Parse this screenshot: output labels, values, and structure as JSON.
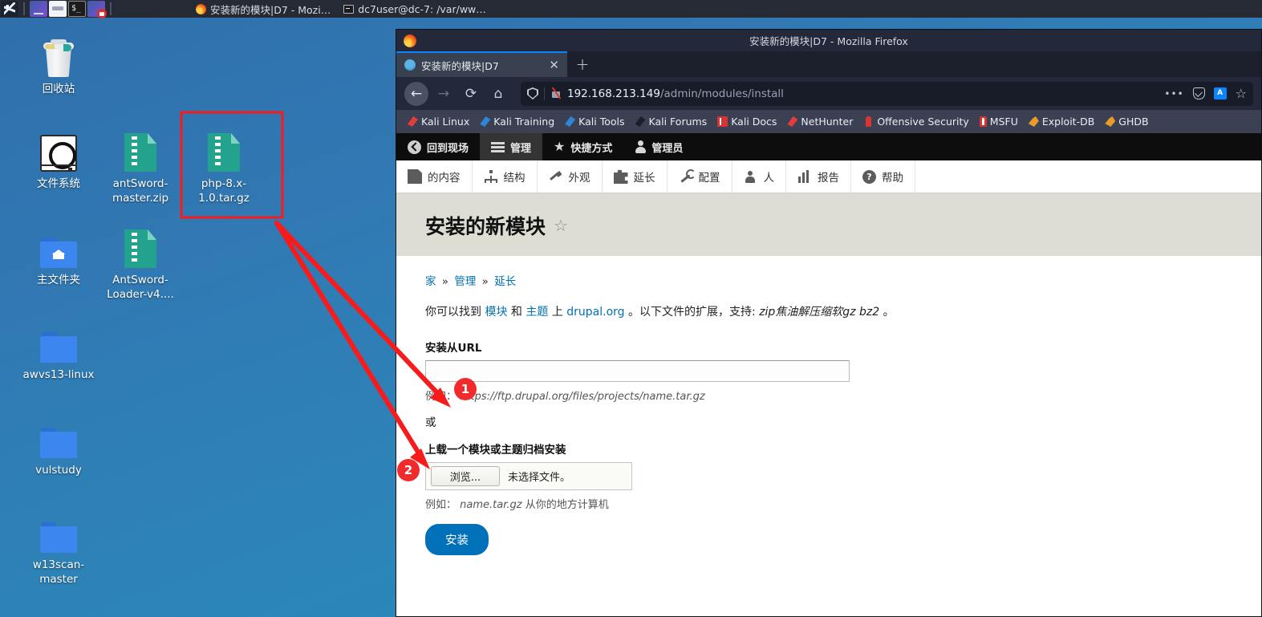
{
  "taskbar": {
    "launchers": [
      {
        "name": "kali-menu",
        "icon": "kali-dragon-icon"
      },
      {
        "name": "files-app",
        "icon": "files-icon"
      },
      {
        "name": "file-manager",
        "icon": "file-manager-icon"
      },
      {
        "name": "terminal",
        "icon": "terminal-icon",
        "glyph": "$_"
      },
      {
        "name": "screen-recorder",
        "icon": "screen-recorder-icon"
      }
    ],
    "windows": [
      {
        "title": "安装新的模块|D7 - Mozi…",
        "icon": "firefox-icon"
      },
      {
        "title": "dc7user@dc-7: /var/ww…",
        "icon": "terminal-icon"
      }
    ]
  },
  "desktop": {
    "icons": [
      {
        "label": "回收站",
        "type": "trash"
      },
      {
        "label": "文件系统",
        "type": "drive"
      },
      {
        "label": "antSword-master.zip",
        "type": "archive"
      },
      {
        "label": "php-8.x-1.0.tar.gz",
        "type": "archive",
        "highlighted": true
      },
      {
        "label": "主文件夹",
        "type": "home"
      },
      {
        "label": "AntSword-Loader-v4....",
        "type": "archive"
      },
      {
        "label": "awvs13-linux",
        "type": "folder"
      },
      {
        "label": "vulstudy",
        "type": "folder"
      },
      {
        "label": "w13scan-master",
        "type": "folder"
      }
    ]
  },
  "annotations": {
    "highlight_color": "#f81b1b",
    "badges": [
      {
        "label": "1"
      },
      {
        "label": "2"
      }
    ]
  },
  "browser": {
    "window_title": "安装新的模块|D7 - Mozilla Firefox",
    "tab": {
      "title": "安装新的模块|D7",
      "close_label": "✕"
    },
    "new_tab_label": "+",
    "nav": {
      "back": "←",
      "forward": "→",
      "reload": "⟳",
      "home": "⌂"
    },
    "url": {
      "domain": "192.168.213.149",
      "path": "/admin/modules/install"
    },
    "url_actions": {
      "more": "•••",
      "pocket": "pocket-icon",
      "translate": "A",
      "bookmark": "☆"
    },
    "bookmarks": [
      {
        "label": "Kali Linux",
        "icon": "kali-icon"
      },
      {
        "label": "Kali Training",
        "icon": "kali-blue-icon"
      },
      {
        "label": "Kali Tools",
        "icon": "kali-blue-icon"
      },
      {
        "label": "Kali Forums",
        "icon": "kali-dark-icon"
      },
      {
        "label": "Kali Docs",
        "icon": "book-icon"
      },
      {
        "label": "NetHunter",
        "icon": "kali-icon"
      },
      {
        "label": "Offensive Security",
        "icon": "tower-icon"
      },
      {
        "label": "MSFU",
        "icon": "msfu-icon"
      },
      {
        "label": "Exploit-DB",
        "icon": "dragon-icon"
      },
      {
        "label": "GHDB",
        "icon": "dragon-icon"
      }
    ]
  },
  "drupal": {
    "top_toolbar": [
      {
        "label": "回到现场",
        "icon": "back-circle-icon",
        "active": false
      },
      {
        "label": "管理",
        "icon": "hamburger-icon",
        "active": true
      },
      {
        "label": "快捷方式",
        "icon": "star-icon",
        "active": false
      },
      {
        "label": "管理员",
        "icon": "person-icon",
        "active": false
      }
    ],
    "admin_menu": [
      {
        "label": "的内容",
        "icon": "document-icon"
      },
      {
        "label": "结构",
        "icon": "structure-icon"
      },
      {
        "label": "外观",
        "icon": "paintbrush-icon"
      },
      {
        "label": "延长",
        "icon": "puzzle-icon"
      },
      {
        "label": "配置",
        "icon": "wrench-icon"
      },
      {
        "label": "人",
        "icon": "people-icon"
      },
      {
        "label": "报告",
        "icon": "bar-chart-icon"
      },
      {
        "label": "帮助",
        "icon": "question-icon"
      }
    ],
    "page_title": "安装的新模块",
    "page_title_star": "☆",
    "breadcrumb": [
      {
        "label": "家"
      },
      {
        "label": "管理"
      },
      {
        "label": "延长"
      }
    ],
    "breadcrumb_separator": "»",
    "intro": {
      "part1": "你可以找到",
      "link1": "模块",
      "part2": "和",
      "link2": "主题",
      "part3": "上",
      "link3": "drupal.org",
      "part4": "。以下文件的扩展，支持:",
      "formats": "zip焦油解压缩软gz bz2",
      "part5": "。"
    },
    "url_field": {
      "label": "安装从URL",
      "value": "",
      "placeholder": "",
      "hint_prefix": "例如：",
      "hint_value": "https://ftp.drupal.org/files/projects/name.tar.gz"
    },
    "or_label": "或",
    "upload_field": {
      "label": "上载一个模块或主题归档安装",
      "browse_label": "浏览...",
      "status": "未选择文件。",
      "hint_prefix": "例如：",
      "hint_value": "name.tar.gz",
      "hint_suffix": "从你的地方计算机"
    },
    "submit_label": "安装",
    "accent_color": "#0071b8"
  }
}
